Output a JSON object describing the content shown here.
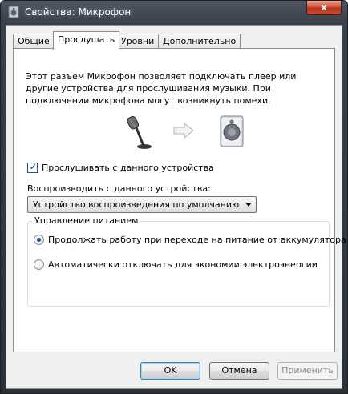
{
  "window": {
    "title": "Свойства: Микрофон",
    "close_glyph": "x"
  },
  "tabs": [
    {
      "label": "Общие",
      "active": false
    },
    {
      "label": "Прослушать",
      "active": true
    },
    {
      "label": "Уровни",
      "active": false
    },
    {
      "label": "Дополнительно",
      "active": false
    }
  ],
  "listen": {
    "description": "Этот разъем Микрофон позволяет подключать плеер или другие устройства для прослушивания музыки. При подключении микрофона могут возникнуть помехи.",
    "checkbox_label": "Прослушивать с данного устройства",
    "checkbox_checked": true,
    "playback_label": "Воспроизводить с данного устройства:",
    "playback_value": "Устройство воспроизведения по умолчанию"
  },
  "power": {
    "legend": "Управление питанием",
    "options": [
      {
        "label": "Продолжать работу при переходе на питание от аккумулятора",
        "selected": true
      },
      {
        "label": "Автоматически отключать для экономии электроэнергии",
        "selected": false
      }
    ]
  },
  "buttons": {
    "ok": "OK",
    "cancel": "Отмена",
    "apply": "Применить"
  },
  "icons": {
    "title": "speaker-icon",
    "microphone": "microphone-icon",
    "arrow": "arrow-right-icon",
    "speaker_device": "speaker-device-icon"
  }
}
